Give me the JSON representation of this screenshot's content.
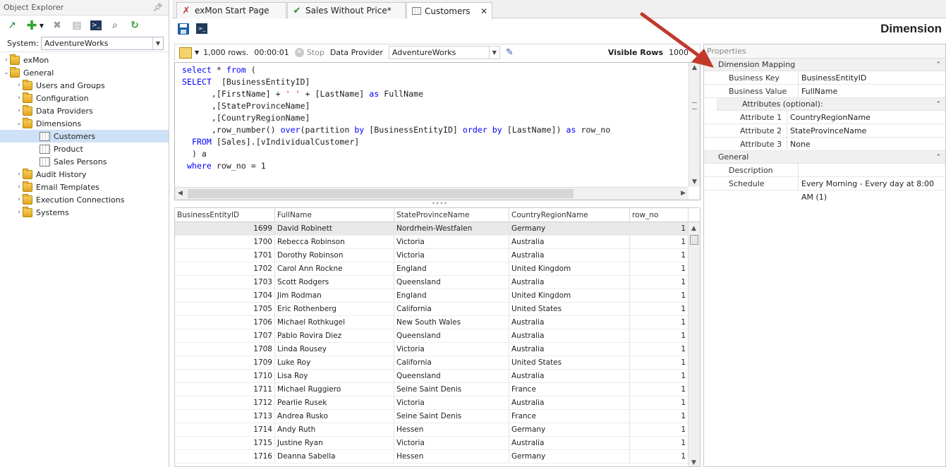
{
  "explorer": {
    "title": "Object Explorer",
    "system_label": "System:",
    "system_value": "AdventureWorks",
    "tree": {
      "exmon": "exMon",
      "general": "General",
      "users_groups": "Users and Groups",
      "configuration": "Configuration",
      "data_providers": "Data Providers",
      "dimensions": "Dimensions",
      "customers": "Customers",
      "product": "Product",
      "sales_persons": "Sales Persons",
      "audit_history": "Audit History",
      "email_templates": "Email Templates",
      "execution_connections": "Execution Connections",
      "systems": "Systems"
    }
  },
  "tabs": {
    "start_page": "exMon Start Page",
    "sales_without_price": "Sales Without Price*",
    "customers": "Customers"
  },
  "header": {
    "title": "Dimension"
  },
  "query_bar": {
    "rows": "1,000 rows.",
    "time": "00:00:01",
    "stop": "Stop",
    "data_provider_label": "Data Provider",
    "data_provider_value": "AdventureWorks",
    "visible_rows_label": "Visible Rows",
    "visible_rows_value": "1000"
  },
  "grid": {
    "columns": [
      "BusinessEntityID",
      "FullName",
      "StateProvinceName",
      "CountryRegionName",
      "row_no"
    ],
    "rows": [
      [
        "1699",
        "David Robinett",
        "Nordrhein-Westfalen",
        "Germany",
        "1"
      ],
      [
        "1700",
        "Rebecca Robinson",
        "Victoria",
        "Australia",
        "1"
      ],
      [
        "1701",
        "Dorothy Robinson",
        "Victoria",
        "Australia",
        "1"
      ],
      [
        "1702",
        "Carol Ann Rockne",
        "England",
        "United Kingdom",
        "1"
      ],
      [
        "1703",
        "Scott Rodgers",
        "Queensland",
        "Australia",
        "1"
      ],
      [
        "1704",
        "Jim Rodman",
        "England",
        "United Kingdom",
        "1"
      ],
      [
        "1705",
        "Eric Rothenberg",
        "California",
        "United States",
        "1"
      ],
      [
        "1706",
        "Michael Rothkugel",
        "New South Wales",
        "Australia",
        "1"
      ],
      [
        "1707",
        "Pablo Rovira Diez",
        "Queensland",
        "Australia",
        "1"
      ],
      [
        "1708",
        "Linda Rousey",
        "Victoria",
        "Australia",
        "1"
      ],
      [
        "1709",
        "Luke Roy",
        "California",
        "United States",
        "1"
      ],
      [
        "1710",
        "Lisa Roy",
        "Queensland",
        "Australia",
        "1"
      ],
      [
        "1711",
        "Michael Ruggiero",
        "Seine Saint Denis",
        "France",
        "1"
      ],
      [
        "1712",
        "Pearlie Rusek",
        "Victoria",
        "Australia",
        "1"
      ],
      [
        "1713",
        "Andrea Rusko",
        "Seine Saint Denis",
        "France",
        "1"
      ],
      [
        "1714",
        "Andy Ruth",
        "Hessen",
        "Germany",
        "1"
      ],
      [
        "1715",
        "Justine Ryan",
        "Victoria",
        "Australia",
        "1"
      ],
      [
        "1716",
        "Deanna Sabella",
        "Hessen",
        "Germany",
        "1"
      ]
    ]
  },
  "properties": {
    "title": "Properties",
    "dimension_mapping": "Dimension Mapping",
    "business_key_label": "Business Key",
    "business_key_value": "BusinessEntityID",
    "business_value_label": "Business Value",
    "business_value_value": "FullName",
    "attributes_label": "Attributes (optional):",
    "attribute1_label": "Attribute 1",
    "attribute1_value": "CountryRegionName",
    "attribute2_label": "Attribute 2",
    "attribute2_value": "StateProvinceName",
    "attribute3_label": "Attribute 3",
    "attribute3_value": "None",
    "general": "General",
    "description_label": "Description",
    "description_value": "",
    "schedule_label": "Schedule",
    "schedule_value": "Every Morning - Every day at 8:00 AM (1)"
  },
  "colors": {
    "accent": "#cfe1f7",
    "keyword": "#0000ff",
    "string": "#ff0000",
    "arrow": "#c0392b"
  }
}
